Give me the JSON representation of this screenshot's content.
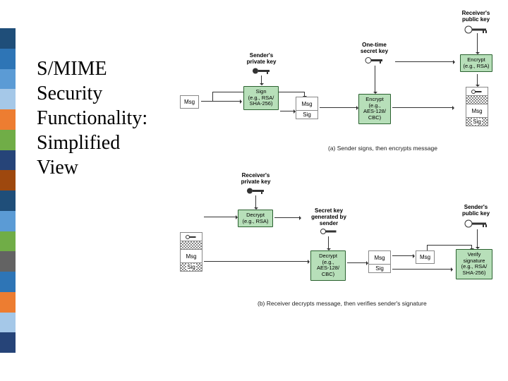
{
  "title": "S/MIME\nSecurity\nFunctionality:\nSimplified\nView",
  "top": {
    "sender_key": "Sender's\nprivate key",
    "receiver_key": "Receiver's\npublic key",
    "onetime_key": "One-time\nsecret key",
    "msg": "Msg",
    "sign": "Sign\n(e.g., RSA/\nSHA-256)",
    "sig": "Sig",
    "encrypt_rsa": "Encrypt\n(e.g., RSA)",
    "encrypt_aes": "Encrypt\n(e.g.,\nAES-128/\nCBC)",
    "caption": "(a) Sender signs, then encrypts message"
  },
  "bot": {
    "receiver_key": "Receiver's\nprivate key",
    "sender_key": "Sender's\npublic key",
    "secret_key": "Secret key\ngenerated by\nsender",
    "msg": "Msg",
    "sig": "Sig",
    "decrypt_rsa": "Decrypt\n(e.g., RSA)",
    "decrypt_aes": "Decrypt\n(e.g.,\nAES-128/\nCBC)",
    "verify": "Verify\nsignature\n(e.g., RSA/\nSHA-256)",
    "caption": "(b) Receiver decrypts message, then verifies sender's signature"
  }
}
